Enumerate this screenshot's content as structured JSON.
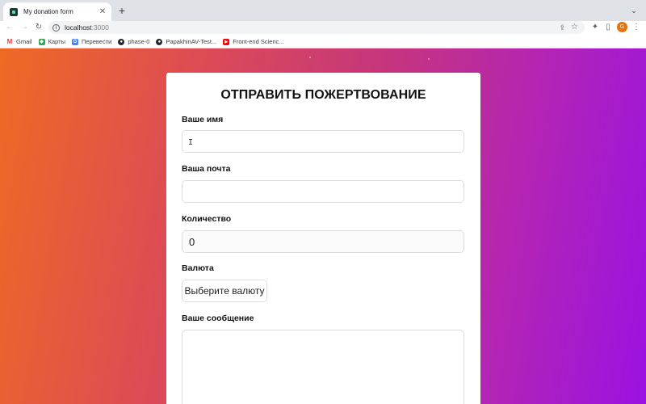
{
  "browser": {
    "tab": {
      "title": "My donation form"
    },
    "address": {
      "host": "localhost",
      "port": ":3000"
    },
    "bookmarks": [
      {
        "label": "Gmail",
        "icon": "gmail-icon"
      },
      {
        "label": "Карты",
        "icon": "maps-icon"
      },
      {
        "label": "Перевести",
        "icon": "translate-icon"
      },
      {
        "label": "phase-0",
        "icon": "github-icon"
      },
      {
        "label": "PapakhinAV-Test...",
        "icon": "github-icon"
      },
      {
        "label": "Front-end Scienc...",
        "icon": "youtube-icon"
      }
    ],
    "profile_initial": "G"
  },
  "form": {
    "title": "ОТПРАВИТЬ ПОЖЕРТВОВАНИЕ",
    "name": {
      "label": "Ваше имя",
      "value": ""
    },
    "email": {
      "label": "Ваша почта",
      "value": ""
    },
    "amount": {
      "label": "Количество",
      "value": "0"
    },
    "currency": {
      "label": "Валюта",
      "button_label": "Выберите валюту"
    },
    "message": {
      "label": "Ваше сообщение",
      "value": ""
    }
  },
  "colors": {
    "gradient_start": "#ee6a24",
    "gradient_end": "#9a12e2",
    "card": "#ffffff"
  }
}
